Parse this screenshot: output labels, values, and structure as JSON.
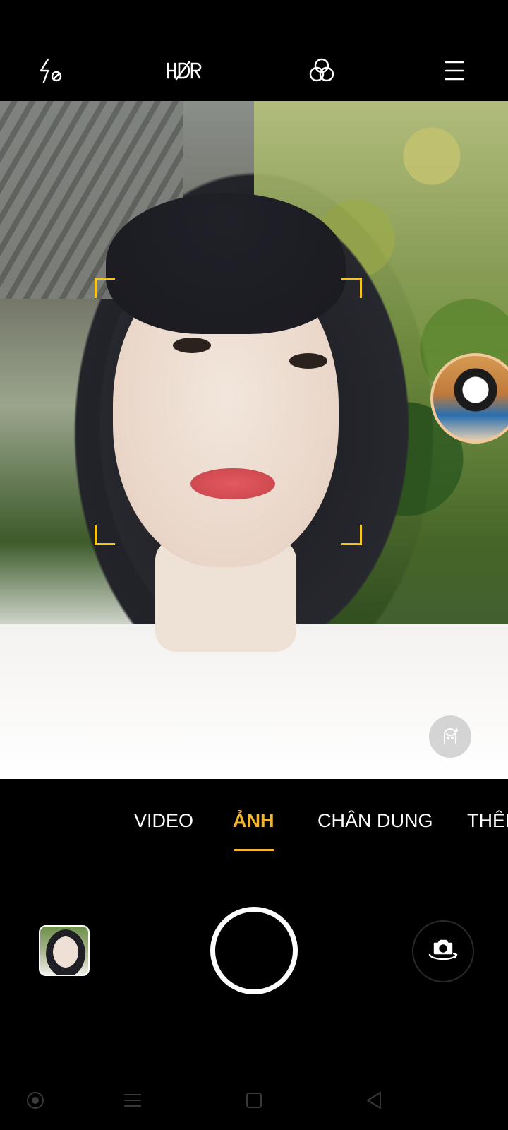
{
  "toolbar": {
    "flash": "flash-auto-icon",
    "hdr": "hdr-off-icon",
    "filter": "filter-icon",
    "menu": "menu-icon"
  },
  "viewfinder": {
    "focus_color": "#f5c518",
    "sticker": "ar-sticker",
    "beauty": "beauty-mode-icon"
  },
  "modes": {
    "video": "VIDEO",
    "photo": "ẢNH",
    "portrait": "CHÂN DUNG",
    "more": "THÊM",
    "active_color": "#f2b72e"
  },
  "controls": {
    "gallery": "gallery-thumbnail",
    "shutter": "shutter-button",
    "switch": "switch-camera-icon"
  },
  "navbar": {
    "assist": "assist-dot-icon",
    "recents": "recents-icon",
    "home": "home-icon",
    "back": "back-icon"
  }
}
